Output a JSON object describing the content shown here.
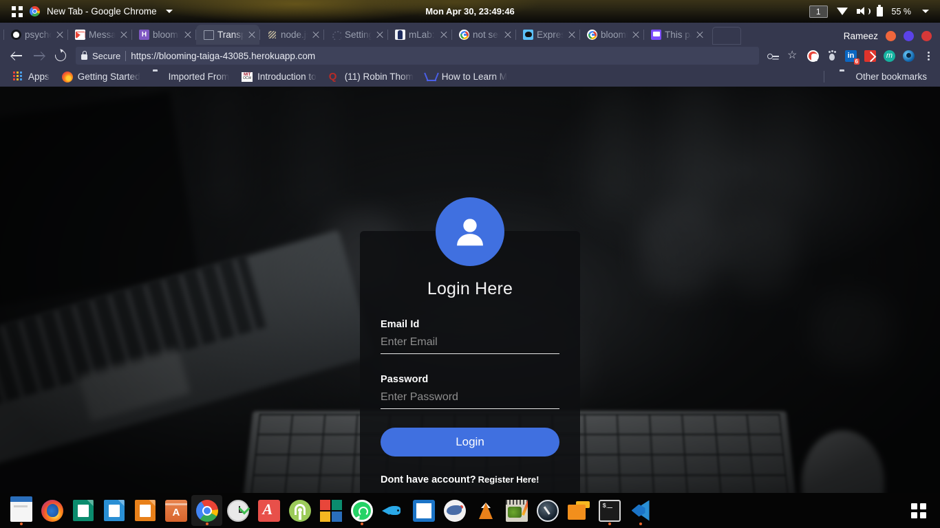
{
  "os_topbar": {
    "activities_icon": "activities-grid-icon",
    "app_icon": "chrome-icon",
    "window_title": "New Tab - Google Chrome",
    "window_menu_caret": "chevron-down-icon",
    "clock": "Mon Apr 30, 23:49:46",
    "workspace_badge": "1",
    "wifi_icon": "wifi-icon",
    "volume_icon": "volume-icon",
    "battery_icon": "battery-icon",
    "battery_percent": "55 %",
    "system_menu_caret": "chevron-down-icon"
  },
  "browser": {
    "tabs": [
      {
        "label": "psycho",
        "favicon": "github-icon",
        "active": false
      },
      {
        "label": "Messag",
        "favicon": "gmail-icon",
        "active": false
      },
      {
        "label": "bloomi",
        "favicon": "heroku-icon",
        "active": false
      },
      {
        "label": "Transp",
        "favicon": "document-icon",
        "active": true
      },
      {
        "label": "node.js",
        "favicon": "nodejs-icon",
        "active": false
      },
      {
        "label": "Setting",
        "favicon": "settings-icon",
        "active": false
      },
      {
        "label": "mLab:",
        "favicon": "mlab-icon",
        "active": false
      },
      {
        "label": "not ser",
        "favicon": "google-icon",
        "active": false
      },
      {
        "label": "Expres",
        "favicon": "express-icon",
        "active": false
      },
      {
        "label": "bloomi",
        "favicon": "google-icon",
        "active": false
      },
      {
        "label": "This pa",
        "favicon": "message-icon",
        "active": false
      }
    ],
    "new_tab_button": "new-tab-button",
    "profile_name": "Rameez",
    "window_buttons": [
      "minimize-button",
      "maximize-button",
      "close-button"
    ],
    "toolbar": {
      "back_icon": "back-arrow-icon",
      "forward_icon": "forward-arrow-icon",
      "reload_icon": "reload-icon",
      "security_icon": "lock-icon",
      "security_label": "Secure",
      "url": "https://blooming-taiga-43085.herokuapp.com",
      "actions": [
        "password-key-icon",
        "bookmark-star-icon",
        "adblock-extension-icon",
        "ghostery-extension-icon",
        "linkedin-extension-icon",
        "pocket-extension-icon",
        "momentum-extension-icon",
        "eye-extension-icon",
        "chrome-menu-icon"
      ],
      "linkedin_badge": "6"
    },
    "bookmarks": [
      {
        "label": "Apps",
        "icon": "apps-grid-icon"
      },
      {
        "label": "Getting Started",
        "icon": "firefox-icon"
      },
      {
        "label": "Imported From",
        "icon": "folder-icon"
      },
      {
        "label": "Introduction to",
        "icon": "mit-ocw-icon"
      },
      {
        "label": "(11) Robin Thom",
        "icon": "quora-icon"
      },
      {
        "label": "How to Learn M",
        "icon": "lambda-icon"
      }
    ],
    "other_bookmarks": {
      "label": "Other bookmarks",
      "icon": "folder-icon"
    }
  },
  "page": {
    "avatar_icon": "user-avatar-icon",
    "title": "Login Here",
    "email": {
      "label": "Email Id",
      "placeholder": "Enter Email",
      "value": ""
    },
    "password": {
      "label": "Password",
      "placeholder": "Enter Password",
      "value": ""
    },
    "login_button": "Login",
    "register_prompt": "Dont have account?",
    "register_link": "Register Here!",
    "accent_color": "#4070e0",
    "card_background": "#0e0f11"
  },
  "dock": {
    "items": [
      {
        "name": "files",
        "icon": "files-icon",
        "running": true
      },
      {
        "name": "firefox",
        "icon": "firefox-icon",
        "running": false
      },
      {
        "name": "libreoffice-calc",
        "icon": "libreoffice-calc-icon",
        "running": false
      },
      {
        "name": "libreoffice-writer",
        "icon": "libreoffice-writer-icon",
        "running": false
      },
      {
        "name": "libreoffice-impress",
        "icon": "libreoffice-impress-icon",
        "running": false
      },
      {
        "name": "software-center",
        "icon": "software-center-icon",
        "running": false
      },
      {
        "name": "google-chrome",
        "icon": "chrome-icon",
        "running": true
      },
      {
        "name": "clock",
        "icon": "clock-icon",
        "running": false
      },
      {
        "name": "acrobat-reader",
        "icon": "pdf-icon",
        "running": false
      },
      {
        "name": "android-studio",
        "icon": "android-studio-icon",
        "running": false
      },
      {
        "name": "microsoft-apps",
        "icon": "microsoft-icon",
        "running": false
      },
      {
        "name": "whatsapp",
        "icon": "whatsapp-icon",
        "running": true
      },
      {
        "name": "wireshark",
        "icon": "wireshark-icon",
        "running": false
      },
      {
        "name": "brackets",
        "icon": "brackets-icon",
        "running": false
      },
      {
        "name": "shark-app",
        "icon": "shark-icon",
        "running": false
      },
      {
        "name": "vlc",
        "icon": "vlc-icon",
        "running": false
      },
      {
        "name": "gimp",
        "icon": "gimp-icon",
        "running": false
      },
      {
        "name": "speedtest",
        "icon": "speedometer-icon",
        "running": false
      },
      {
        "name": "xmind",
        "icon": "xmind-icon",
        "running": false
      },
      {
        "name": "terminal",
        "icon": "terminal-icon",
        "running": true
      },
      {
        "name": "visual-studio-code",
        "icon": "vscode-icon",
        "running": true
      }
    ],
    "show_applications": "show-applications-icon"
  }
}
